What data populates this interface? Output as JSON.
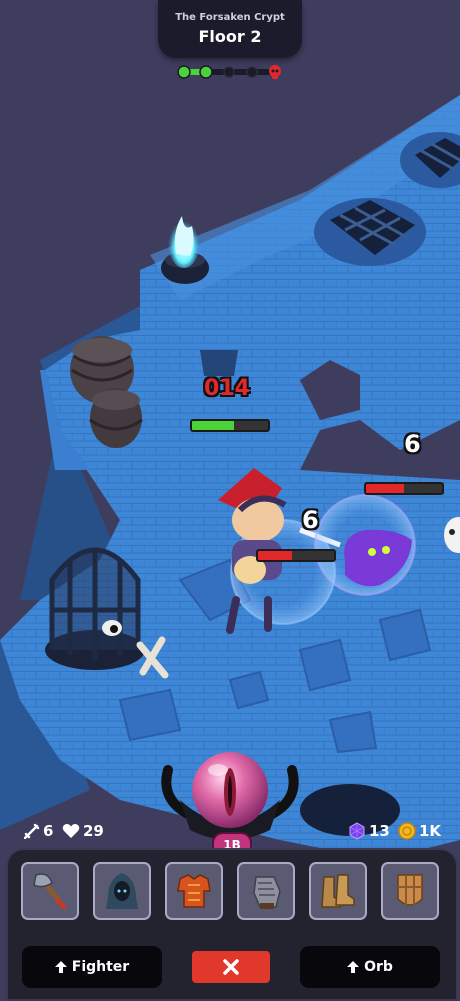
{
  "header": {
    "dungeon_name": "The Forsaken Crypt",
    "floor_label": "Floor 2",
    "progress": {
      "total_nodes": 5,
      "completed_nodes": 2,
      "boss_icon": "skull-icon"
    }
  },
  "combat": {
    "damage_numbers": [
      "014",
      "6",
      "6"
    ],
    "player_health": 0.55,
    "enemy_health": [
      0.5,
      0.45
    ]
  },
  "stats": {
    "attack_value": "6",
    "health_value": "29",
    "gems_value": "13",
    "coins_value": "1K"
  },
  "orb": {
    "badge": "1B"
  },
  "equipment": [
    {
      "icon": "axe-icon"
    },
    {
      "icon": "hood-icon"
    },
    {
      "icon": "chest-armor-icon"
    },
    {
      "icon": "gauntlet-icon"
    },
    {
      "icon": "boots-icon"
    },
    {
      "icon": "shield-icon"
    }
  ],
  "actions": {
    "left_label": "Fighter",
    "right_label": "Orb"
  },
  "colors": {
    "floor_tile": "#3e86d6",
    "wall_dark": "#2c5d9e",
    "background": "#3f3d5e",
    "progress_green": "#4bd43a",
    "close_red": "#e0382b",
    "orb_pink": "#e06aa8"
  }
}
